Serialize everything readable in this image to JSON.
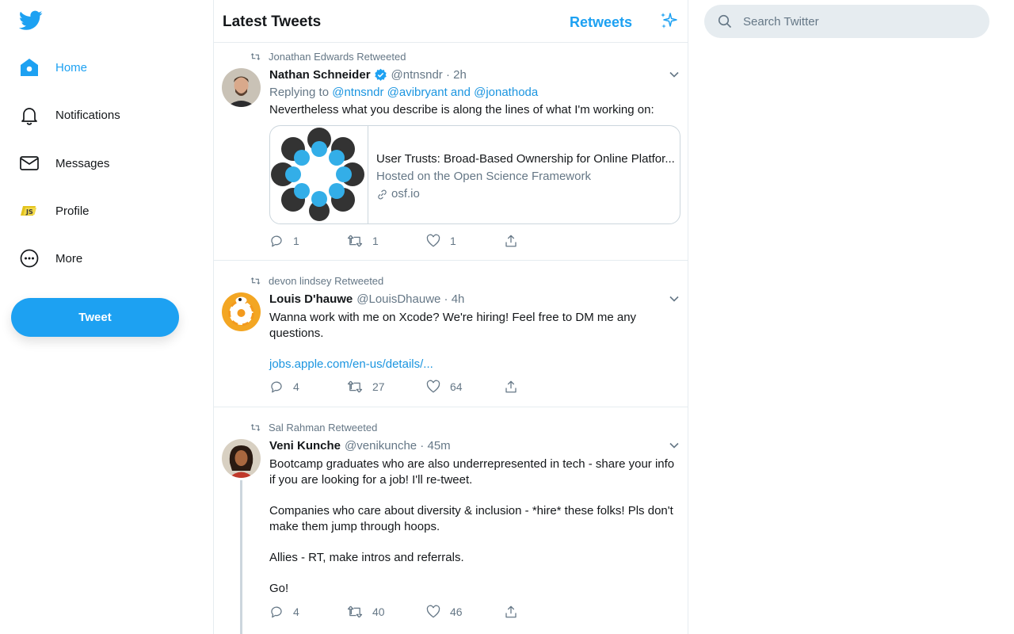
{
  "nav": {
    "items": [
      {
        "label": "Home",
        "icon": "home-icon"
      },
      {
        "label": "Notifications",
        "icon": "bell-icon"
      },
      {
        "label": "Messages",
        "icon": "envelope-icon"
      },
      {
        "label": "Profile",
        "icon": "profile-avatar-icon"
      },
      {
        "label": "More",
        "icon": "more-circle-icon"
      }
    ],
    "tweet_button": "Tweet"
  },
  "header": {
    "title": "Latest Tweets",
    "retweets": "Retweets"
  },
  "search": {
    "placeholder": "Search Twitter"
  },
  "colors": {
    "accent": "#1da1f2",
    "link": "#1b95e0",
    "secondary_text": "#657786",
    "border": "#e6ecf0"
  },
  "tweets": [
    {
      "retweeted_by": "Jonathan Edwards Retweeted",
      "name": "Nathan Schneider",
      "verified": true,
      "meta": "@ntnsndr · 2h",
      "replying_prefix": "Replying to",
      "replying_links": "@ntnsndr @avibryant and @jonathoda",
      "text": "Nevertheless what you describe is along the lines of what I'm working on:",
      "card": {
        "title": "User Trusts: Broad-Based Ownership for Online Platfor...",
        "desc": "Hosted on the Open Science Framework",
        "url": "osf.io"
      },
      "replies": "1",
      "retweets": "1",
      "likes": "1"
    },
    {
      "retweeted_by": "devon lindsey Retweeted",
      "name": "Louis D'hauwe",
      "meta": "@LouisDhauwe · 4h",
      "text_line1": "Wanna work with me on Xcode? We're hiring! Feel free to DM me any",
      "text_line2": "questions.",
      "link": "jobs.apple.com/en-us/details/...",
      "replies": "4",
      "retweets": "27",
      "likes": "64"
    },
    {
      "retweeted_by": "Sal Rahman Retweeted",
      "name": "Veni Kunche",
      "meta": "@venikunche · 45m",
      "p1_line1": "Bootcamp graduates who are also underrepresented in tech - share your info",
      "p1_line2": "if you are looking for a job! I'll re-tweet.",
      "p2_line1": "Companies who care about diversity & inclusion - *hire* these folks! Pls don't",
      "p2_line2": "make them jump through hoops.",
      "p3": "Allies - RT, make intros and referrals.",
      "p4": "Go!",
      "replies": "4",
      "retweets": "40",
      "likes": "46"
    }
  ]
}
